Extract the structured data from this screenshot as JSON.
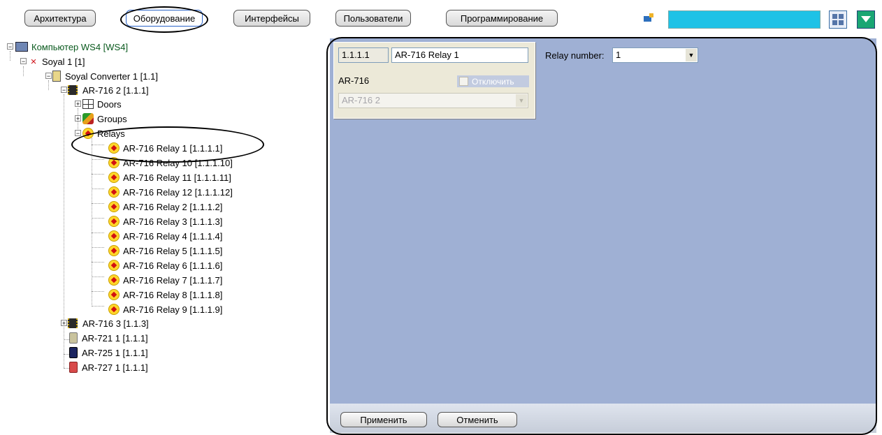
{
  "tabs": [
    {
      "label": "Архитектура"
    },
    {
      "label": "Оборудование"
    },
    {
      "label": "Интерфейсы"
    },
    {
      "label": "Пользователи"
    },
    {
      "label": "Программирование"
    }
  ],
  "active_tab": "Оборудование",
  "tree": {
    "computer": "Компьютер WS4 [WS4]",
    "soyal": "Soyal 1 [1]",
    "converter": "Soyal Converter 1 [1.1]",
    "ar716_2": "AR-716 2 [1.1.1]",
    "doors": "Doors",
    "groups": "Groups",
    "relays": "Relays",
    "relay_items": [
      "AR-716 Relay 1 [1.1.1.1]",
      "AR-716 Relay 10 [1.1.1.10]",
      "AR-716 Relay 11 [1.1.1.11]",
      "AR-716 Relay 12 [1.1.1.12]",
      "AR-716 Relay 2 [1.1.1.2]",
      "AR-716 Relay 3 [1.1.1.3]",
      "AR-716 Relay 4 [1.1.1.4]",
      "AR-716 Relay 5 [1.1.1.5]",
      "AR-716 Relay 6 [1.1.1.6]",
      "AR-716 Relay 7 [1.1.1.7]",
      "AR-716 Relay 8 [1.1.1.8]",
      "AR-716 Relay 9 [1.1.1.9]"
    ],
    "ar716_3": "AR-716 3 [1.1.3]",
    "ar721": "AR-721 1 [1.1.1]",
    "ar725": "AR-725 1 [1.1.1]",
    "ar727": "AR-727 1 [1.1.1]"
  },
  "settings": {
    "id_value": "1.1.1.1",
    "name_value": "AR-716 Relay 1",
    "type_label": "AR-716",
    "disable_label": "Отключить",
    "parent_value": "AR-716 2",
    "relay_number_label": "Relay number:",
    "relay_number_value": "1"
  },
  "buttons": {
    "apply": "Применить",
    "cancel": "Отменить"
  },
  "colors": {
    "panel_bg": "#9fb0d4",
    "search_bg": "#1ec2e6",
    "relay_icon": "#ffd62a",
    "computer_label": "#0a5a1e"
  }
}
